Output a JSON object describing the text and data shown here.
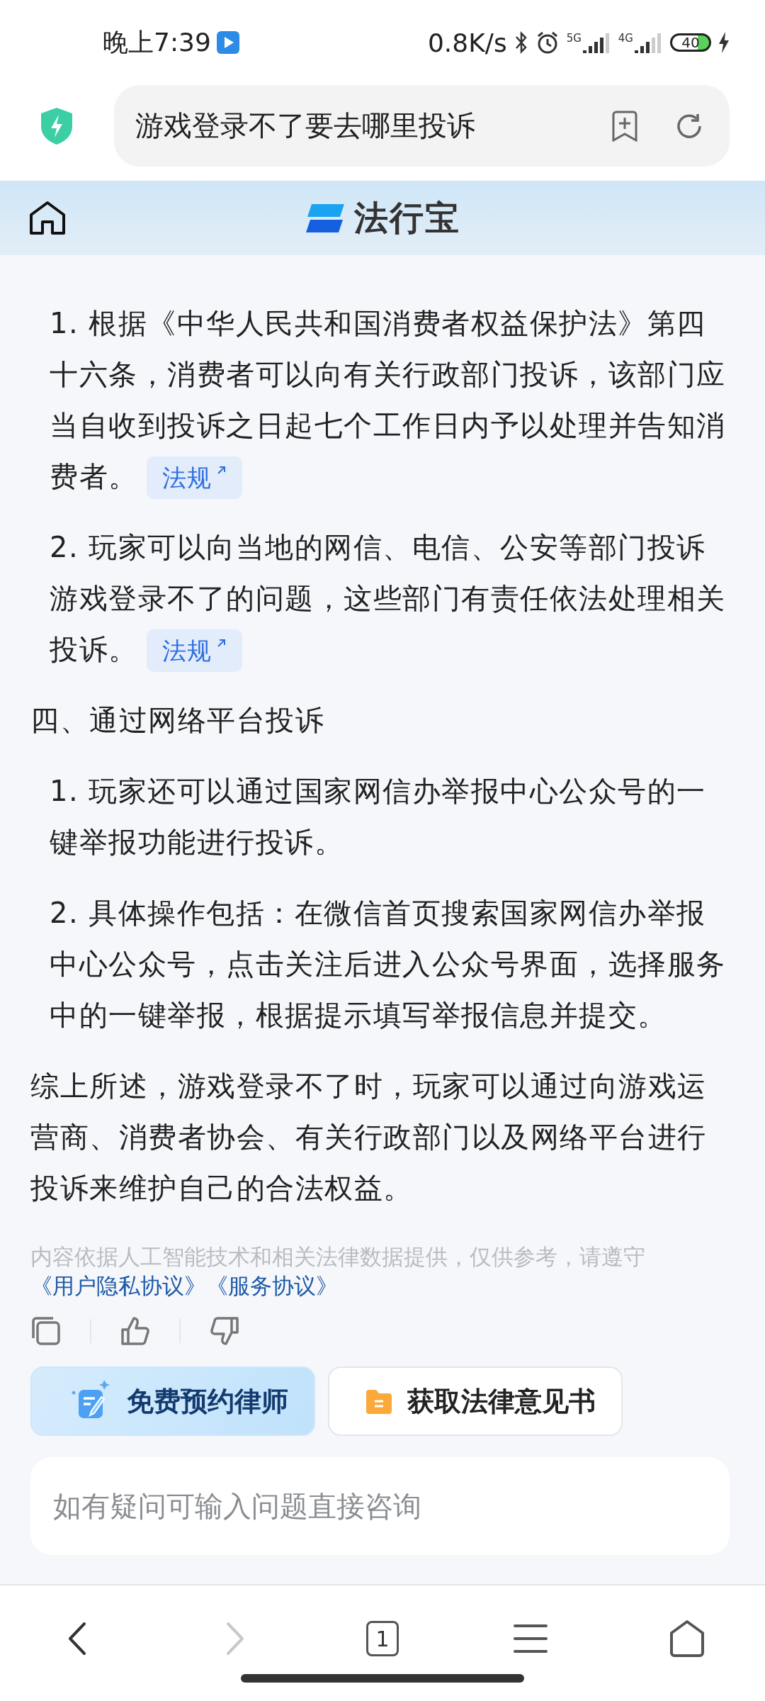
{
  "status_bar": {
    "time": "晚上7:39",
    "speed": "0.8K/s",
    "network_1": "5G",
    "network_2": "4G",
    "battery": "40"
  },
  "address_bar": {
    "query": "游戏登录不了要去哪里投诉"
  },
  "header": {
    "logo_text": "法行宝"
  },
  "content": [
    {
      "kind": "item",
      "text": "1. 根据《中华人民共和国消费者权益保护法》第四十六条，消费者可以向有关行政部门投诉，该部门应当自收到投诉之日起七个工作日内予以处理并告知消费者。",
      "link": "法规"
    },
    {
      "kind": "item",
      "text": "2. 玩家可以向当地的网信、电信、公安等部门投诉游戏登录不了的问题，这些部门有责任依法处理相关投诉。",
      "link": "法规"
    },
    {
      "kind": "heading",
      "text": "四、通过网络平台投诉"
    },
    {
      "kind": "item",
      "text": "1. 玩家还可以通过国家网信办举报中心公众号的一键举报功能进行投诉。"
    },
    {
      "kind": "item",
      "text": "2. 具体操作包括：在微信首页搜索国家网信办举报中心公众号，点击关注后进入公众号界面，选择服务中的一键举报，根据提示填写举报信息并提交。"
    },
    {
      "kind": "paragraph",
      "text": "综上所述，游戏登录不了时，玩家可以通过向游戏运营商、消费者协会、有关行政部门以及网络平台进行投诉来维护自己的合法权益。"
    }
  ],
  "disclaimer": {
    "text": "内容依据人工智能技术和相关法律数据提供，仅供参考，请遵守",
    "links": [
      "《用户隐私协议》",
      "《服务协议》"
    ]
  },
  "actions": [
    {
      "kind": "primary",
      "label": "免费预约律师"
    },
    {
      "kind": "secondary",
      "label": "获取法律意见书"
    }
  ],
  "input": {
    "placeholder": "如有疑问可输入问题直接咨询"
  },
  "bottom_nav": {
    "tab_count": "1",
    "forward_disabled": true
  }
}
